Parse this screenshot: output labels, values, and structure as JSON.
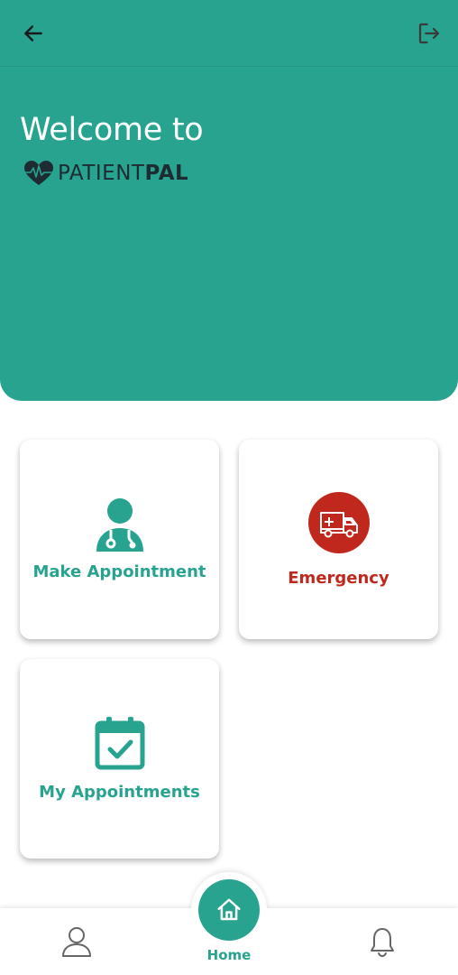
{
  "header": {
    "back_icon": "arrow-left-icon",
    "logout_icon": "logout-icon",
    "welcome_text": "Welcome to",
    "logo": {
      "light_text": "PATIENT",
      "bold_text": "PAL",
      "icon": "heart-pulse-icon"
    }
  },
  "cards": [
    {
      "label": "Make Appointment",
      "icon": "doctor-icon",
      "color": "#27a38f"
    },
    {
      "label": "Emergency",
      "icon": "ambulance-icon",
      "color": "#c0281d"
    },
    {
      "label": "My Appointments",
      "icon": "calendar-check-icon",
      "color": "#27a38f"
    }
  ],
  "bottom_nav": {
    "profile_icon": "user-icon",
    "home_label": "Home",
    "home_icon": "home-icon",
    "notifications_icon": "bell-icon"
  },
  "colors": {
    "primary": "#27a38f",
    "emergency": "#c0281d",
    "background": "#ffffff"
  }
}
